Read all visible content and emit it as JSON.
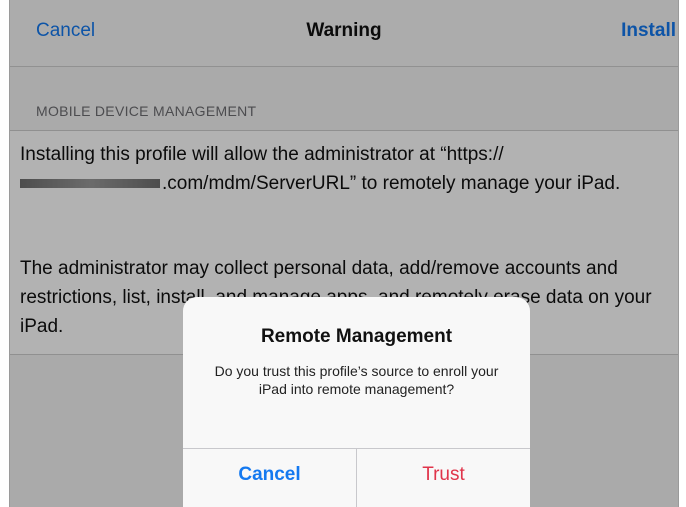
{
  "navbar": {
    "cancel_label": "Cancel",
    "title": "Warning",
    "install_label": "Install"
  },
  "section": {
    "header": "MOBILE DEVICE MANAGEMENT"
  },
  "body": {
    "para1_start": "Installing this profile will allow the administrator at “https://",
    "para1_url_tail": ".com/mdm/ServerURL” to remotely manage your iPad.",
    "para2": "The administrator may collect personal data, add/remove accounts and restrictions, list, install, and manage apps, and remotely erase data on your iPad."
  },
  "alert": {
    "title": "Remote Management",
    "message": "Do you trust this profile’s source to enroll your iPad into remote management?",
    "cancel_label": "Cancel",
    "trust_label": "Trust"
  },
  "colors": {
    "accent": "#1479f0",
    "destructive": "#e0344a"
  }
}
